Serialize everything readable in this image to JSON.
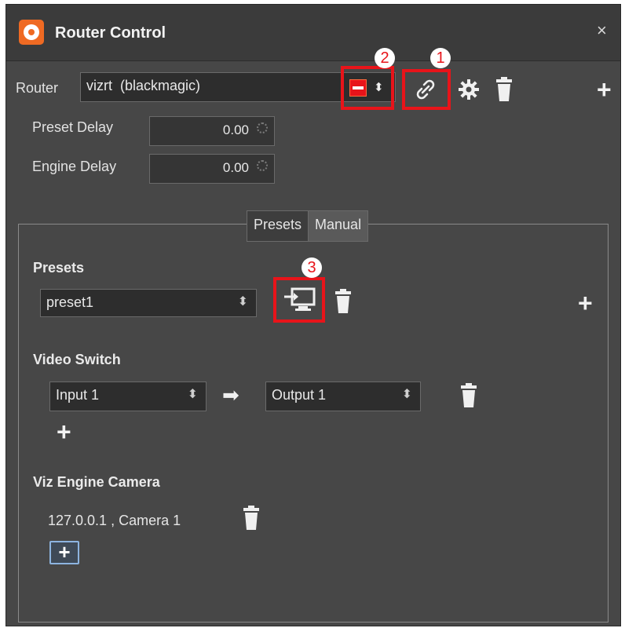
{
  "window": {
    "title": "Router Control",
    "close_glyph": "×"
  },
  "router": {
    "label": "Router",
    "selected": "vizrt  (blackmagic)",
    "preset_delay_label": "Preset Delay",
    "preset_delay_value": "0.00",
    "engine_delay_label": "Engine Delay",
    "engine_delay_value": "0.00"
  },
  "annotations": {
    "one": "1",
    "two": "2",
    "three": "3"
  },
  "tabs": {
    "presets": "Presets",
    "manual": "Manual"
  },
  "presets": {
    "heading": "Presets",
    "selected": "preset1"
  },
  "video_switch": {
    "heading": "Video Switch",
    "input": "Input 1",
    "output": "Output 1",
    "arrow": "➡"
  },
  "camera": {
    "heading": "Viz Engine Camera",
    "entry": "127.0.0.1 , Camera 1"
  },
  "glyphs": {
    "plus": "+",
    "arrows": "⬍"
  },
  "colors": {
    "accent": "#ef6a23",
    "highlight": "#e8141a",
    "panel": "#474747"
  },
  "icons": [
    "app-logo-icon",
    "close-icon",
    "remove-icon",
    "link-icon",
    "gear-icon",
    "trash-icon",
    "plus-icon",
    "apply-preset-icon",
    "arrow-right-icon"
  ]
}
